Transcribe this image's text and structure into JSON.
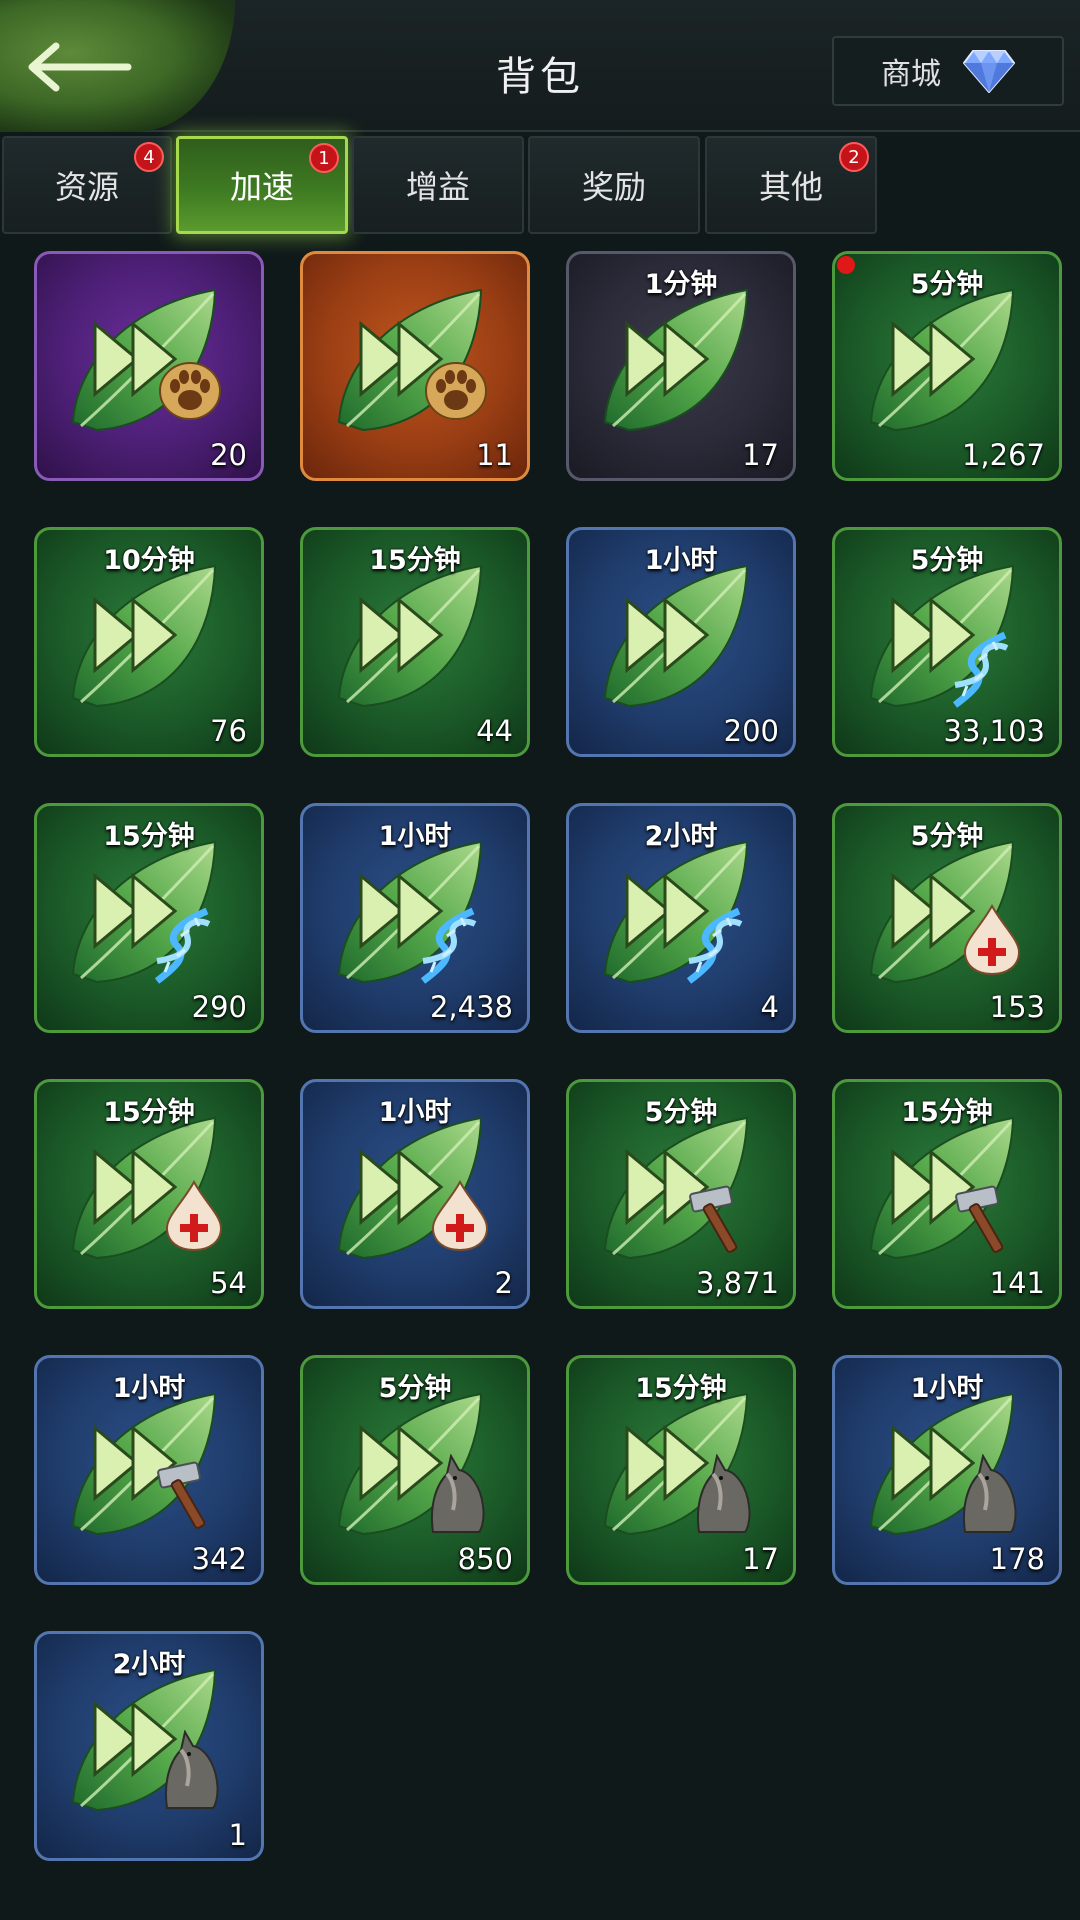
{
  "header": {
    "title": "背包",
    "shop_label": "商城"
  },
  "tabs": [
    {
      "label": "资源",
      "badge": "4",
      "active": false
    },
    {
      "label": "加速",
      "badge": "1",
      "active": true
    },
    {
      "label": "增益",
      "badge": "",
      "active": false
    },
    {
      "label": "奖励",
      "badge": "",
      "active": false
    },
    {
      "label": "其他",
      "badge": "2",
      "active": false
    }
  ],
  "items": [
    {
      "duration": "",
      "count": "20",
      "tier": "purple",
      "icon": "paw-icon",
      "new": false
    },
    {
      "duration": "",
      "count": "11",
      "tier": "orange",
      "icon": "paw-icon",
      "new": false
    },
    {
      "duration": "1分钟",
      "count": "17",
      "tier": "dark",
      "icon": "",
      "new": false
    },
    {
      "duration": "5分钟",
      "count": "1,267",
      "tier": "green",
      "icon": "",
      "new": true
    },
    {
      "duration": "10分钟",
      "count": "76",
      "tier": "green",
      "icon": "",
      "new": false
    },
    {
      "duration": "15分钟",
      "count": "44",
      "tier": "green",
      "icon": "",
      "new": false
    },
    {
      "duration": "1小时",
      "count": "200",
      "tier": "blue",
      "icon": "",
      "new": false
    },
    {
      "duration": "5分钟",
      "count": "33,103",
      "tier": "green",
      "icon": "dna-icon",
      "new": false
    },
    {
      "duration": "15分钟",
      "count": "290",
      "tier": "green",
      "icon": "dna-icon",
      "new": false
    },
    {
      "duration": "1小时",
      "count": "2,438",
      "tier": "blue",
      "icon": "dna-icon",
      "new": false
    },
    {
      "duration": "2小时",
      "count": "4",
      "tier": "blue",
      "icon": "dna-icon",
      "new": false
    },
    {
      "duration": "5分钟",
      "count": "153",
      "tier": "green",
      "icon": "blood-drop-icon",
      "new": false
    },
    {
      "duration": "15分钟",
      "count": "54",
      "tier": "green",
      "icon": "blood-drop-icon",
      "new": false
    },
    {
      "duration": "1小时",
      "count": "2",
      "tier": "blue",
      "icon": "blood-drop-icon",
      "new": false
    },
    {
      "duration": "5分钟",
      "count": "3,871",
      "tier": "green",
      "icon": "hammer-icon",
      "new": false
    },
    {
      "duration": "15分钟",
      "count": "141",
      "tier": "green",
      "icon": "hammer-icon",
      "new": false
    },
    {
      "duration": "1小时",
      "count": "342",
      "tier": "blue",
      "icon": "hammer-icon",
      "new": false
    },
    {
      "duration": "5分钟",
      "count": "850",
      "tier": "green",
      "icon": "wolf-icon",
      "new": false
    },
    {
      "duration": "15分钟",
      "count": "17",
      "tier": "green",
      "icon": "wolf-icon",
      "new": false
    },
    {
      "duration": "1小时",
      "count": "178",
      "tier": "blue",
      "icon": "wolf-icon",
      "new": false
    },
    {
      "duration": "2小时",
      "count": "1",
      "tier": "blue",
      "icon": "wolf-icon",
      "new": false
    }
  ]
}
